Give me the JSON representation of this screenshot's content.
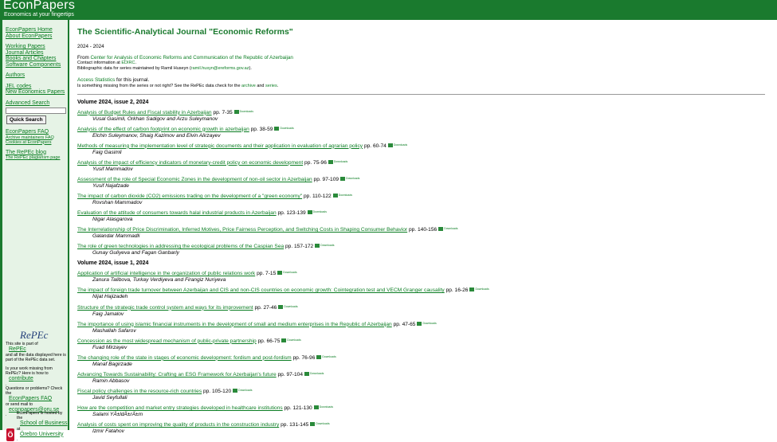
{
  "header": {
    "logo": "EconPapers",
    "tagline": "Economics at your fingertips"
  },
  "sidebar": {
    "links": [
      "EconPapers Home",
      "About EconPapers",
      "",
      "Working Papers",
      "Journal Articles",
      "Books and Chapters",
      "Software Components",
      "",
      "Authors",
      "",
      "JEL codes",
      "New Economics Papers",
      "",
      "Advanced Search"
    ],
    "search_button": "Quick Search",
    "faq": "EconPapers FAQ",
    "faq_sub": [
      "Archive maintainers FAQ",
      "Cookies at EconPapers"
    ],
    "blog": "The RePEc blog",
    "blog_sub": "The RePEc plagiarism page",
    "repec_logo": "RePEc",
    "repec_note": [
      "This site is part of",
      "RePEc",
      "and all the data displayed here is part of the RePEc data set."
    ],
    "missing_note": [
      "Is your work missing from RePEc? Here is how to",
      "contribute",
      "."
    ],
    "questions_note": [
      "Questions or problems? Check the",
      "EconPapers FAQ",
      "or send mail to",
      "econpapers@oru.se",
      "."
    ],
    "hosted_note": [
      "EconPapers is hosted by the",
      "School of Business",
      "at",
      "Örebro University",
      "."
    ]
  },
  "main": {
    "title": "The Scientific-Analytical Journal \"Economic Reforms\"",
    "years": "2024 - 2024",
    "from_prefix": "From",
    "from_link": "Center for Analysis of Economic Reforms and Communication of the Republic of Azerbaijan",
    "contact_prefix": "Contact information at",
    "contact_link": "EDIRC",
    "contact_suffix": ".",
    "biblio_prefix": "Bibliographic data for series maintained by Ramil Huseyn (",
    "biblio_email": "ramil.husyn@ereforms.gov.az",
    "biblio_suffix": ").",
    "access_link": "Access Statistics",
    "access_suffix": "for this journal.",
    "missing_prefix": "Is something missing from the series or not right? See the RePEc data check for the",
    "missing_archive": "archive",
    "missing_and": "and",
    "missing_series": "series",
    "missing_end": ".",
    "download_label": "Downloads",
    "volumes": [
      {
        "heading": "Volume 2024, issue 2, 2024",
        "articles": [
          {
            "title": "Analysis of Budget Rules and Fiscal stability in Azerbaijan",
            "pages": "pp. 7-35",
            "authors": "Vusal Gasimli, Orkhan Sadigov and Arzu Suleymanov"
          },
          {
            "title": "Analysis of the effect of carbon footprint on economic growth in azerbaijan",
            "pages": "pp. 38-59",
            "authors": "Elchin Suleymanov, Shaig Kazimov and Elvin Alirzayev"
          },
          {
            "title": "Methods of measuring the implementation level of strategic documents and their application in evaluation of agrarian policy",
            "pages": "pp. 60-74",
            "authors": "Faig Gasimli"
          },
          {
            "title": "Analysis of the impact of efficiency indicators of monetary-credit policy on economic development",
            "pages": "pp. 75-96",
            "authors": "Yusif Mammadov"
          },
          {
            "title": "Assessment of the role of Special Economic Zones in the development of non-oil sector in Azerbaijan",
            "pages": "pp. 97-109",
            "authors": "Yusif Najafzade"
          },
          {
            "title": "The impact of carbon dioxide (CO2) emissions trading on the development of a \"green economy\"",
            "pages": "pp. 110-122",
            "authors": "Rovshan Mammadov"
          },
          {
            "title": "Evaluation of the attitude of consumers towards halal industrial products in Azerbaijan",
            "pages": "pp. 123-139",
            "authors": "Nigar Alasgarova"
          },
          {
            "title": "The Interrelationship of Price Discrimination, Inferred Motives, Price Fairness Perception, and Switching Costs in Shaping Consumer Behavior",
            "pages": "pp. 140-156",
            "authors": "Galandar Mammadli"
          },
          {
            "title": "The role of green technologies in addressing the ecological problems of the Caspian Sea",
            "pages": "pp. 157-172",
            "authors": "Gunay Guliyeva and Fagan Ganbarly"
          }
        ]
      },
      {
        "heading": "Volume 2024, issue 1, 2024",
        "articles": [
          {
            "title": "Application of artificial intelligence in the organization of public relations work",
            "pages": "pp. 7-15",
            "authors": "Zanura Talibova, Turkay Verdiyeva and Firangiz Nuriyeva"
          },
          {
            "title": "The impact of foreign trade turnover between Azerbaijan and CIS and non-CIS countries on economic growth: Cointegration test and VECM Granger causality",
            "pages": "pp. 16-26",
            "authors": "Nijat Hajizadeh"
          },
          {
            "title": "Structure of the strategic trade control system and ways for its improvement",
            "pages": "pp. 27-46",
            "authors": "Faig Jamalov"
          },
          {
            "title": "The importance of using islamic financial instruments in the development of small and medium enterprises in the Republic of Azerbaijan",
            "pages": "pp. 47-65",
            "authors": "Mashallah Safarov"
          },
          {
            "title": "Concession as the most widespread mechanism of public-private partnership",
            "pages": "pp. 66-75",
            "authors": "Fuad Mirzayev"
          },
          {
            "title": "The changing role of the state in stages of economic development: fordism and post-fordism",
            "pages": "pp. 76-96",
            "authors": "Manaf Bagirzade"
          },
          {
            "title": "Advancing Towards Sustainability: Crafting an ESG Framework for Azerbaijan's future",
            "pages": "pp. 97-104",
            "authors": "Ramin Abbasov"
          },
          {
            "title": "Fiscal policy challenges in the resource-rich countries",
            "pages": "pp. 105-120",
            "authors": "Javid Seyfullali"
          },
          {
            "title": "How are the competition and market entry strategies developed in healthcare institutions",
            "pages": "pp. 121-130",
            "authors": "Salami YÄ±ldÄ±rÄ±m"
          },
          {
            "title": "Analysis of costs spent on improving the quality of products in the construction industry",
            "pages": "pp. 131-145",
            "authors": "Izmir Fatahov"
          }
        ]
      }
    ]
  }
}
